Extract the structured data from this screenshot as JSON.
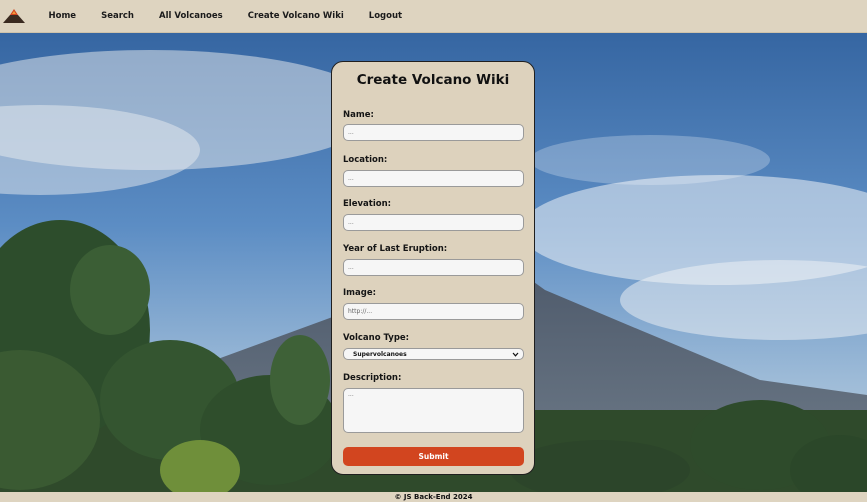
{
  "nav": {
    "items": [
      {
        "label": "Home"
      },
      {
        "label": "Search"
      },
      {
        "label": "All Volcanoes"
      },
      {
        "label": "Create Volcano Wiki"
      },
      {
        "label": "Logout"
      }
    ]
  },
  "form": {
    "title": "Create Volcano Wiki",
    "name": {
      "label": "Name:",
      "placeholder": "..."
    },
    "location": {
      "label": "Location:",
      "placeholder": "..."
    },
    "elevation": {
      "label": "Elevation:",
      "placeholder": "..."
    },
    "eruption": {
      "label": "Year of Last Eruption:",
      "placeholder": "..."
    },
    "image": {
      "label": "Image:",
      "placeholder": "http://..."
    },
    "type": {
      "label": "Volcano Type:",
      "selected": "Supervolcanoes"
    },
    "description": {
      "label": "Description:",
      "placeholder": "..."
    },
    "submit_label": "Submit"
  },
  "footer": {
    "text": "© JS Back-End 2024"
  },
  "colors": {
    "nav_bg": "#ded4c0",
    "card_bg": "#ddd2bd",
    "accent": "#d2451f"
  },
  "icons": {
    "logo": "volcano-logo-icon",
    "select": "chevron-down-icon"
  }
}
